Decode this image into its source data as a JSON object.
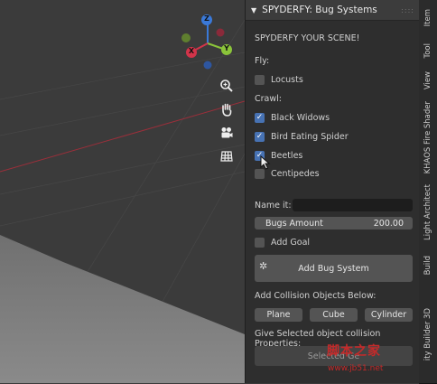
{
  "viewport": {
    "gizmo": {
      "x_label": "X",
      "y_label": "Y",
      "z_label": "Z"
    },
    "tools": [
      {
        "icon": "zoom-icon",
        "glyph": "⊕"
      },
      {
        "icon": "hand-pan-icon",
        "glyph": "✋"
      },
      {
        "icon": "camera-icon",
        "glyph": "🎥"
      },
      {
        "icon": "grid-icon",
        "glyph": "▦"
      }
    ]
  },
  "panel": {
    "title": "SPYDERFY: Bug Systems",
    "intro": "SPYDERFY YOUR SCENE!",
    "fly_label": "Fly:",
    "locusts": {
      "label": "Locusts",
      "checked": false
    },
    "crawl_label": "Crawl:",
    "black_widows": {
      "label": "Black Widows",
      "checked": true
    },
    "bird_eating_spider": {
      "label": "Bird Eating Spider",
      "checked": true
    },
    "beetles": {
      "label": "Beetles",
      "checked": true
    },
    "centipedes": {
      "label": "Centipedes",
      "checked": false
    },
    "name_label": "Name it:",
    "name_value": "",
    "bugs_amount_label": "Bugs Amount",
    "bugs_amount_value": "200.00",
    "add_goal": {
      "label": "Add Goal",
      "checked": false
    },
    "add_bug_system": "Add Bug System",
    "collision_label": "Add Collision Objects Below:",
    "plane": "Plane",
    "cube": "Cube",
    "cylinder": "Cylinder",
    "props_label": "Give Selected object collision Properties:",
    "selected_button": "Selected Ge"
  },
  "tabs": [
    {
      "label": "Item"
    },
    {
      "label": "Tool"
    },
    {
      "label": "View"
    },
    {
      "label": "KHAOS Fire Shader"
    },
    {
      "label": "Light Architect"
    },
    {
      "label": "Build"
    },
    {
      "label": "ity Builder 3D"
    }
  ],
  "watermark": {
    "text": "脚本之家",
    "url": "www.jb51.net"
  },
  "colors": {
    "accent": "#4772b3",
    "x_axis": "#d2344a",
    "y_axis": "#8bc43a",
    "z_axis": "#3a79d8"
  }
}
